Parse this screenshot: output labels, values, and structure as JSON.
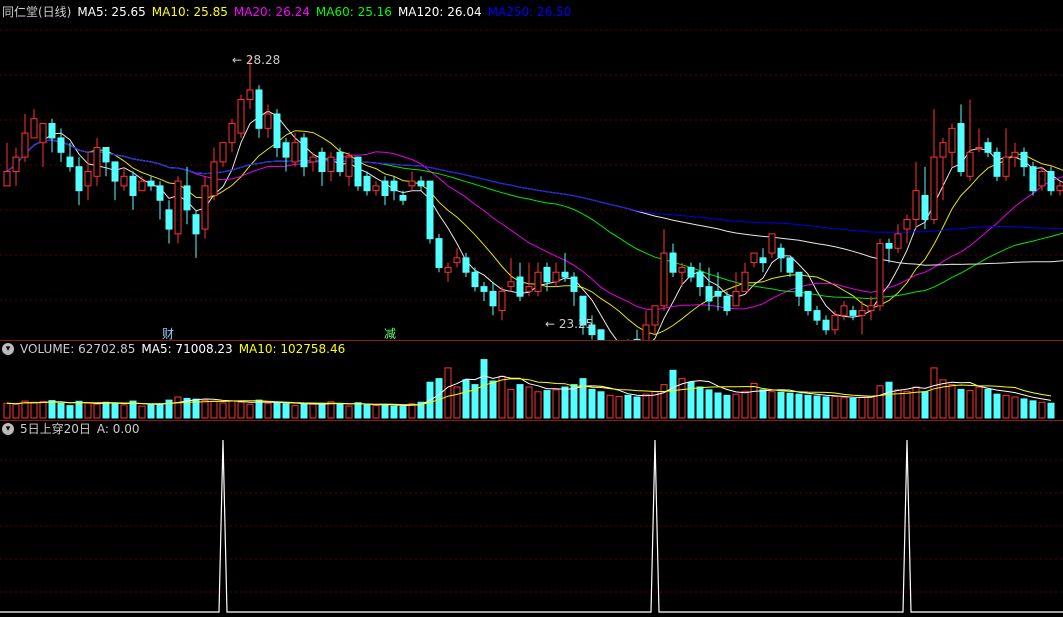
{
  "chart_data": [
    {
      "type": "candlestick",
      "title": "同仁堂(日线)",
      "legend": [
        {
          "label": "MA5: 25.65",
          "color": "#ffffff"
        },
        {
          "label": "MA10: 25.85",
          "color": "#ffff00"
        },
        {
          "label": "MA20: 26.24",
          "color": "#ff00ff"
        },
        {
          "label": "MA60: 25.16",
          "color": "#00ff00"
        },
        {
          "label": "MA120: 26.04",
          "color": "#ffffff"
        },
        {
          "label": "MA250: 26.50",
          "color": "#0000ff"
        }
      ],
      "annotations": {
        "high": "28.28",
        "low": "23.25"
      },
      "markers": [
        {
          "text": "财",
          "color": "#99ccff"
        },
        {
          "text": "减",
          "color": "#66ff66"
        }
      ],
      "ylim": [
        22.7,
        29.1
      ],
      "candles": [
        [
          25.6,
          25.9,
          25.6,
          26.5
        ],
        [
          25.9,
          26.2,
          25.6,
          26.4
        ],
        [
          26.2,
          26.7,
          26.1,
          27.1
        ],
        [
          26.6,
          27.0,
          26.6,
          27.2
        ],
        [
          26.5,
          26.9,
          26.0,
          26.9
        ],
        [
          26.9,
          26.6,
          26.3,
          27.0
        ],
        [
          26.6,
          26.3,
          26.1,
          26.8
        ],
        [
          26.2,
          26.0,
          25.9,
          26.5
        ],
        [
          26.0,
          25.5,
          25.2,
          26.2
        ],
        [
          25.6,
          25.9,
          25.3,
          26.3
        ],
        [
          25.8,
          26.4,
          25.6,
          26.6
        ],
        [
          26.4,
          26.1,
          25.8,
          26.4
        ],
        [
          26.1,
          25.7,
          25.3,
          26.1
        ],
        [
          25.6,
          25.8,
          25.5,
          26.0
        ],
        [
          25.8,
          25.4,
          25.1,
          25.9
        ],
        [
          25.5,
          25.7,
          25.5,
          25.8
        ],
        [
          25.7,
          25.6,
          25.5,
          25.8
        ],
        [
          25.6,
          25.3,
          24.9,
          25.7
        ],
        [
          25.1,
          24.7,
          24.4,
          25.3
        ],
        [
          24.6,
          25.7,
          24.4,
          25.8
        ],
        [
          25.6,
          25.1,
          24.8,
          26.0
        ],
        [
          25.0,
          24.6,
          24.1,
          25.1
        ],
        [
          24.7,
          25.6,
          24.5,
          25.8
        ],
        [
          25.4,
          26.1,
          25.3,
          26.4
        ],
        [
          26.1,
          26.5,
          26.0,
          26.5
        ],
        [
          26.5,
          26.9,
          26.3,
          27.0
        ],
        [
          26.7,
          27.4,
          26.6,
          27.5
        ],
        [
          27.4,
          27.6,
          27.2,
          28.3
        ],
        [
          27.6,
          26.8,
          26.6,
          27.7
        ],
        [
          26.8,
          27.1,
          26.6,
          27.3
        ],
        [
          27.1,
          26.4,
          26.2,
          27.2
        ],
        [
          26.5,
          26.2,
          25.9,
          26.6
        ],
        [
          26.1,
          26.5,
          26.0,
          26.7
        ],
        [
          26.6,
          26.0,
          25.8,
          26.7
        ],
        [
          26.1,
          26.2,
          25.9,
          26.3
        ],
        [
          26.3,
          25.9,
          25.6,
          26.4
        ],
        [
          25.9,
          26.2,
          25.7,
          26.3
        ],
        [
          26.3,
          25.9,
          25.8,
          26.4
        ],
        [
          25.8,
          26.2,
          25.6,
          26.3
        ],
        [
          26.2,
          25.6,
          25.5,
          26.2
        ],
        [
          25.8,
          25.5,
          25.4,
          25.9
        ],
        [
          25.5,
          25.6,
          25.4,
          25.7
        ],
        [
          25.7,
          25.4,
          25.2,
          25.8
        ],
        [
          25.7,
          25.5,
          25.3,
          25.8
        ],
        [
          25.4,
          25.3,
          25.2,
          25.5
        ],
        [
          25.6,
          25.7,
          25.5,
          25.9
        ],
        [
          25.7,
          25.6,
          25.5,
          25.8
        ],
        [
          25.7,
          24.5,
          24.4,
          25.7
        ],
        [
          24.5,
          23.9,
          23.8,
          24.6
        ],
        [
          23.8,
          23.9,
          23.6,
          24.0
        ],
        [
          24.0,
          24.1,
          23.9,
          24.3
        ],
        [
          24.1,
          23.8,
          23.7,
          24.2
        ],
        [
          23.8,
          23.5,
          23.4,
          23.9
        ],
        [
          23.5,
          23.4,
          23.2,
          23.6
        ],
        [
          23.4,
          23.1,
          22.9,
          23.6
        ],
        [
          23.0,
          23.4,
          22.8,
          23.5
        ],
        [
          23.5,
          23.6,
          23.4,
          24.1
        ],
        [
          23.7,
          23.3,
          23.2,
          24.0
        ],
        [
          23.4,
          23.5,
          23.3,
          24.0
        ],
        [
          23.4,
          23.8,
          23.3,
          24.0
        ],
        [
          23.9,
          23.6,
          23.4,
          24.0
        ],
        [
          23.6,
          23.8,
          23.5,
          24.0
        ],
        [
          23.8,
          23.7,
          23.6,
          24.2
        ],
        [
          23.7,
          23.4,
          23.1,
          23.8
        ],
        [
          23.3,
          22.7,
          22.5,
          23.3
        ],
        [
          22.7,
          22.5,
          22.4,
          22.9
        ],
        [
          22.6,
          22.2,
          22.0,
          22.6
        ],
        [
          22.1,
          22.1,
          22.0,
          22.2
        ],
        [
          22.1,
          22.1,
          22.0,
          22.2
        ],
        [
          22.2,
          22.1,
          22.0,
          22.4
        ],
        [
          22.4,
          22.1,
          22.1,
          22.6
        ],
        [
          22.3,
          22.7,
          22.1,
          23.0
        ],
        [
          22.7,
          23.1,
          22.5,
          23.1
        ],
        [
          23.1,
          24.2,
          23.0,
          24.7
        ],
        [
          24.2,
          23.8,
          23.7,
          24.4
        ],
        [
          23.8,
          23.9,
          23.5,
          24.0
        ],
        [
          23.9,
          23.7,
          23.6,
          24.0
        ],
        [
          23.8,
          23.5,
          23.3,
          24.0
        ],
        [
          23.5,
          23.2,
          23.0,
          23.9
        ],
        [
          23.4,
          23.3,
          23.0,
          23.8
        ],
        [
          23.3,
          23.0,
          22.9,
          23.4
        ],
        [
          23.1,
          23.4,
          23.1,
          23.8
        ],
        [
          23.4,
          23.8,
          23.4,
          24.0
        ],
        [
          24.0,
          24.2,
          23.9,
          24.2
        ],
        [
          24.1,
          24.0,
          23.8,
          24.3
        ],
        [
          24.2,
          24.6,
          24.1,
          24.6
        ],
        [
          24.3,
          24.1,
          23.8,
          24.4
        ],
        [
          24.1,
          23.8,
          23.7,
          24.1
        ],
        [
          23.8,
          23.3,
          23.1,
          23.8
        ],
        [
          23.4,
          23.0,
          22.9,
          23.4
        ],
        [
          23.0,
          22.8,
          22.7,
          23.1
        ],
        [
          22.8,
          22.6,
          22.5,
          22.9
        ],
        [
          22.6,
          22.9,
          22.5,
          23.0
        ],
        [
          22.9,
          23.1,
          22.8,
          23.2
        ],
        [
          23.0,
          22.9,
          22.8,
          23.1
        ],
        [
          22.9,
          23.0,
          22.5,
          23.2
        ],
        [
          23.0,
          23.1,
          22.8,
          23.3
        ],
        [
          23.1,
          24.4,
          23.0,
          24.5
        ],
        [
          24.4,
          24.3,
          24.0,
          24.5
        ],
        [
          24.3,
          24.6,
          24.2,
          24.8
        ],
        [
          24.7,
          24.9,
          24.4,
          25.0
        ],
        [
          24.9,
          25.5,
          24.7,
          26.1
        ],
        [
          25.4,
          24.9,
          24.7,
          26.0
        ],
        [
          24.9,
          26.2,
          24.8,
          27.2
        ],
        [
          26.2,
          26.5,
          25.3,
          26.6
        ],
        [
          26.3,
          26.8,
          26.0,
          26.9
        ],
        [
          26.9,
          25.9,
          25.8,
          27.3
        ],
        [
          25.8,
          26.3,
          25.7,
          27.4
        ],
        [
          26.4,
          26.4,
          26.3,
          26.8
        ],
        [
          26.5,
          26.3,
          26.2,
          26.6
        ],
        [
          26.3,
          25.8,
          25.7,
          26.4
        ],
        [
          25.8,
          26.2,
          25.7,
          26.8
        ],
        [
          26.2,
          26.3,
          26.0,
          26.5
        ],
        [
          26.3,
          26.0,
          25.8,
          26.4
        ],
        [
          26.0,
          25.5,
          25.4,
          26.1
        ],
        [
          25.6,
          25.9,
          25.5,
          26.0
        ],
        [
          25.9,
          25.5,
          25.4,
          26.0
        ],
        [
          25.5,
          25.6,
          25.4,
          25.7
        ],
        [
          25.6,
          25.6,
          25.5,
          25.7
        ]
      ],
      "ma_lines": [
        {
          "name": "MA5",
          "color": "#ffffff"
        },
        {
          "name": "MA10",
          "color": "#ffff00"
        },
        {
          "name": "MA20",
          "color": "#ff00ff"
        },
        {
          "name": "MA60",
          "color": "#00ff00"
        },
        {
          "name": "MA120",
          "color": "#ffffff"
        },
        {
          "name": "MA250",
          "color": "#0000ff"
        }
      ]
    },
    {
      "type": "bar",
      "title": "VOLUME",
      "legend": [
        {
          "label": "VOLUME: 62702.85",
          "color": "#cccccc"
        },
        {
          "label": "MA5: 71008.23",
          "color": "#ffffff"
        },
        {
          "label": "MA10: 102758.46",
          "color": "#ffff00"
        }
      ],
      "ylim": [
        0,
        260000
      ],
      "volumes": [
        62000,
        58000,
        71000,
        66000,
        69000,
        73000,
        61000,
        52000,
        70000,
        63000,
        58000,
        66000,
        60000,
        55000,
        71000,
        50000,
        54000,
        57000,
        75000,
        88000,
        82000,
        79000,
        74000,
        70000,
        63000,
        72000,
        66000,
        58000,
        75000,
        62000,
        66000,
        60000,
        52000,
        60000,
        58000,
        62000,
        68000,
        57000,
        50000,
        64000,
        55000,
        53000,
        57000,
        50000,
        48000,
        60000,
        66000,
        150000,
        165000,
        210000,
        130000,
        160000,
        140000,
        245000,
        155000,
        175000,
        120000,
        140000,
        130000,
        110000,
        115000,
        118000,
        130000,
        140000,
        165000,
        120000,
        110000,
        95000,
        90000,
        95000,
        88000,
        100000,
        110000,
        140000,
        200000,
        165000,
        150000,
        130000,
        118000,
        105000,
        95000,
        100000,
        112000,
        145000,
        118000,
        110000,
        108000,
        104000,
        100000,
        95000,
        92000,
        88000,
        90000,
        85000,
        82000,
        86000,
        90000,
        135000,
        150000,
        118000,
        112000,
        130000,
        110000,
        210000,
        160000,
        140000,
        120000,
        115000,
        130000,
        120000,
        100000,
        95000,
        88000,
        80000,
        72000,
        66000,
        62000
      ]
    },
    {
      "type": "line",
      "title": "5日上穿20日",
      "legend": [
        {
          "label": "A: 0.00",
          "color": "#cccccc"
        }
      ],
      "ylim": [
        0,
        1
      ],
      "signal_index": [
        24,
        72,
        100
      ]
    }
  ]
}
